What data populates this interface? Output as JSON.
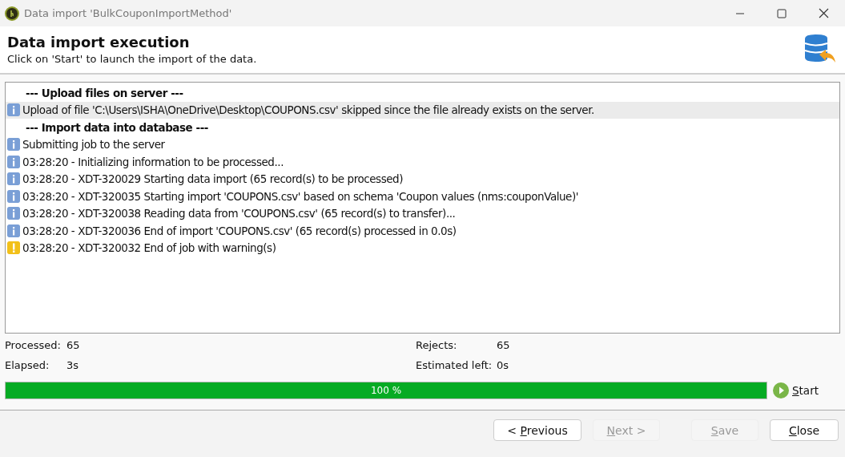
{
  "window": {
    "title": "Data import 'BulkCouponImportMethod'"
  },
  "header": {
    "title": "Data import execution",
    "subtitle": "Click on 'Start' to launch the import of the data."
  },
  "log": [
    {
      "kind": "header",
      "text": "--- Upload files on server ---",
      "selected": false
    },
    {
      "kind": "info",
      "text": "Upload of file 'C:\\Users\\ISHA\\OneDrive\\Desktop\\COUPONS.csv' skipped since the file already exists on the server.",
      "selected": true
    },
    {
      "kind": "header",
      "text": "--- Import data into database ---",
      "selected": false
    },
    {
      "kind": "info",
      "text": "Submitting job to the server",
      "selected": false
    },
    {
      "kind": "info",
      "text": "03:28:20 - Initializing information to be processed...",
      "selected": false
    },
    {
      "kind": "info",
      "text": "03:28:20 - XDT-320029 Starting data import (65 record(s) to be processed)",
      "selected": false
    },
    {
      "kind": "info",
      "text": "03:28:20 - XDT-320035 Starting import 'COUPONS.csv' based on schema 'Coupon values (nms:couponValue)'",
      "selected": false
    },
    {
      "kind": "info",
      "text": "03:28:20 - XDT-320038 Reading data from 'COUPONS.csv' (65 record(s) to transfer)...",
      "selected": false
    },
    {
      "kind": "info",
      "text": "03:28:20 - XDT-320036 End of import 'COUPONS.csv' (65 record(s) processed in 0.0s)",
      "selected": false
    },
    {
      "kind": "warning",
      "text": "03:28:20 - XDT-320032 End of job with warning(s)",
      "selected": false
    }
  ],
  "stats": [
    {
      "label": "Processed:",
      "value": "65"
    },
    {
      "label": "Rejects:",
      "value": "65"
    },
    {
      "label": "Elapsed:",
      "value": "3s"
    },
    {
      "label": "Estimated left:",
      "value": "0s"
    }
  ],
  "progress": {
    "level": 1,
    "reading": "100 %"
  },
  "start_button": {
    "key": "S",
    "after": "tart"
  },
  "buttons": [
    {
      "before": "< ",
      "key": "P",
      "after": "revious",
      "disabled": false
    },
    {
      "key": "N",
      "after": "ext >",
      "disabled": true
    },
    {
      "key": "S",
      "after": "ave",
      "disabled": true
    },
    {
      "key": "C",
      "after": "lose",
      "disabled": false
    }
  ]
}
